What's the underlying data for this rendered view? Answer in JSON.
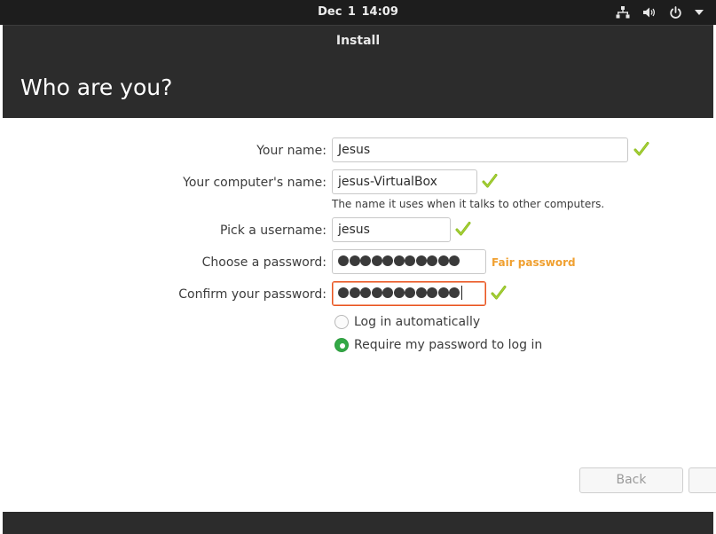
{
  "topbar": {
    "date": "Dec 1",
    "time": "14:09",
    "icons": [
      "network-icon",
      "volume-icon",
      "power-icon",
      "chevron-down-icon"
    ]
  },
  "window": {
    "title": "Install",
    "page_title": "Who are you?"
  },
  "form": {
    "name": {
      "label": "Your name:",
      "value": "Jesus",
      "valid": true
    },
    "computer": {
      "label": "Your computer's name:",
      "value": "jesus-VirtualBox",
      "hint": "The name it uses when it talks to other computers.",
      "valid": true
    },
    "username": {
      "label": "Pick a username:",
      "value": "jesus",
      "valid": true
    },
    "password": {
      "label": "Choose a password:",
      "masked_length": 11,
      "strength": "Fair password"
    },
    "confirm": {
      "label": "Confirm your password:",
      "masked_length": 11,
      "valid": true
    },
    "login_options": [
      {
        "label": "Log in automatically",
        "selected": false
      },
      {
        "label": "Require my password to log in",
        "selected": true
      }
    ]
  },
  "buttons": {
    "back": "Back",
    "continue": ""
  },
  "colors": {
    "header_bg": "#2c2c2c",
    "topbar_bg": "#1d1d1d",
    "check_green": "#8dbd1e",
    "focus_orange": "#e95420",
    "strength_orange": "#f0a030",
    "radio_green": "#33a946"
  }
}
